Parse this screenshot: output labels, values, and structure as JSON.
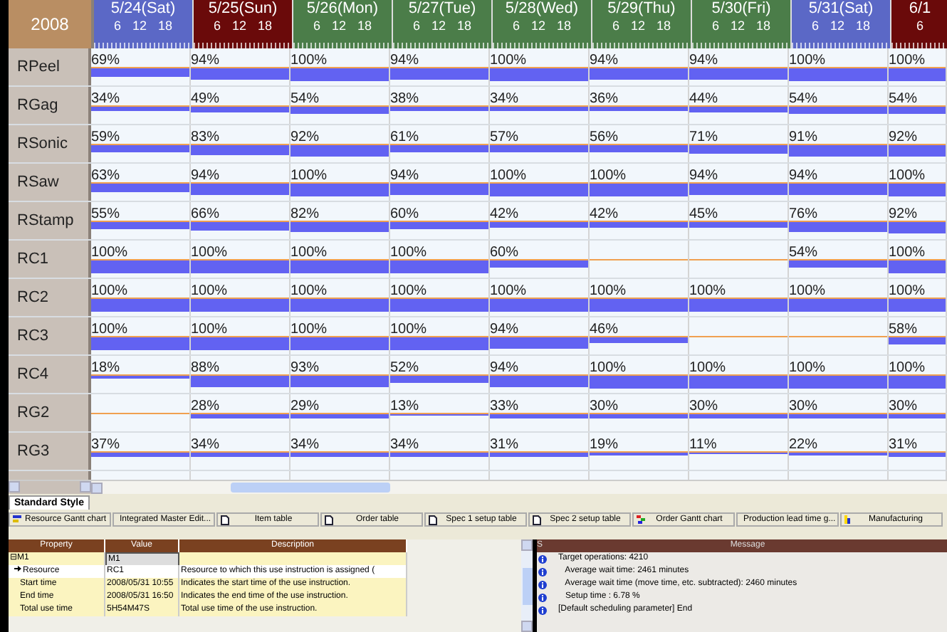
{
  "corner": "2008",
  "days": [
    {
      "label": "5/24(Sat)",
      "kind": "sat",
      "ticks": [
        "6",
        "12",
        "18"
      ]
    },
    {
      "label": "5/25(Sun)",
      "kind": "sun",
      "ticks": [
        "6",
        "12",
        "18"
      ]
    },
    {
      "label": "5/26(Mon)",
      "kind": "weekday",
      "ticks": [
        "6",
        "12",
        "18"
      ]
    },
    {
      "label": "5/27(Tue)",
      "kind": "weekday",
      "ticks": [
        "6",
        "12",
        "18"
      ]
    },
    {
      "label": "5/28(Wed)",
      "kind": "weekday",
      "ticks": [
        "6",
        "12",
        "18"
      ]
    },
    {
      "label": "5/29(Thu)",
      "kind": "weekday",
      "ticks": [
        "6",
        "12",
        "18"
      ]
    },
    {
      "label": "5/30(Fri)",
      "kind": "weekday",
      "ticks": [
        "6",
        "12",
        "18"
      ]
    },
    {
      "label": "5/31(Sat)",
      "kind": "sat",
      "ticks": [
        "6",
        "12",
        "18"
      ]
    },
    {
      "label": "6/1",
      "kind": "sun",
      "ticks": [
        "6"
      ]
    }
  ],
  "resources": [
    {
      "name": "RPeel",
      "cells": [
        "69%",
        "94%",
        "100%",
        "94%",
        "100%",
        "94%",
        "94%",
        "100%",
        "100%"
      ]
    },
    {
      "name": "RGag",
      "cells": [
        "34%",
        "49%",
        "54%",
        "38%",
        "34%",
        "36%",
        "44%",
        "54%",
        "54%"
      ]
    },
    {
      "name": "RSonic",
      "cells": [
        "59%",
        "83%",
        "92%",
        "61%",
        "57%",
        "56%",
        "71%",
        "91%",
        "92%"
      ]
    },
    {
      "name": "RSaw",
      "cells": [
        "63%",
        "94%",
        "100%",
        "94%",
        "100%",
        "100%",
        "94%",
        "94%",
        "100%"
      ]
    },
    {
      "name": "RStamp",
      "cells": [
        "55%",
        "66%",
        "82%",
        "60%",
        "42%",
        "42%",
        "45%",
        "76%",
        "92%"
      ]
    },
    {
      "name": "RC1",
      "cells": [
        "100%",
        "100%",
        "100%",
        "100%",
        "60%",
        null,
        null,
        "54%",
        "100%"
      ]
    },
    {
      "name": "RC2",
      "cells": [
        "100%",
        "100%",
        "100%",
        "100%",
        "100%",
        "100%",
        "100%",
        "100%",
        "100%"
      ]
    },
    {
      "name": "RC3",
      "cells": [
        "100%",
        "100%",
        "100%",
        "100%",
        "94%",
        "46%",
        null,
        null,
        "58%"
      ]
    },
    {
      "name": "RC4",
      "cells": [
        "18%",
        "88%",
        "93%",
        "52%",
        "94%",
        "100%",
        "100%",
        "100%",
        "100%"
      ]
    },
    {
      "name": "RG2",
      "cells": [
        null,
        "28%",
        "29%",
        "13%",
        "33%",
        "30%",
        "30%",
        "30%",
        "30%"
      ]
    },
    {
      "name": "RG3",
      "cells": [
        "37%",
        "34%",
        "34%",
        "34%",
        "31%",
        "19%",
        "11%",
        "22%",
        "31%"
      ]
    }
  ],
  "style_tab": "Standard Style",
  "views": [
    {
      "label": "Resource Gantt chart",
      "kind": "gantt"
    },
    {
      "label": "Integrated Master Edit...",
      "kind": "table"
    },
    {
      "label": "Item table",
      "kind": "table"
    },
    {
      "label": "Order table",
      "kind": "table"
    },
    {
      "label": "Spec 1 setup table",
      "kind": "table"
    },
    {
      "label": "Spec 2 setup table",
      "kind": "table"
    },
    {
      "label": "Order Gantt chart",
      "kind": "order"
    },
    {
      "label": "Production lead time g...",
      "kind": "gantt"
    },
    {
      "label": "Manufacturing",
      "kind": "chart"
    }
  ],
  "properties": {
    "columns": [
      "Property",
      "Value",
      "Description"
    ],
    "rows": [
      {
        "property": "⊟M1",
        "value": "M1",
        "kind": "group"
      },
      {
        "property": "Resource",
        "value": "RC1",
        "description": "Resource to which this use instruction is assigned (",
        "kind": "link"
      },
      {
        "property": "Start time",
        "value": "2008/05/31 10:55",
        "description": "Indicates the start time of the use instruction.",
        "kind": "item"
      },
      {
        "property": "End time",
        "value": "2008/05/31 16:50",
        "description": "Indicates the end time of the use instruction.",
        "kind": "item"
      },
      {
        "property": "Total use time",
        "value": "5H54M47S",
        "description": "Total use time of the use instruction.",
        "kind": "item"
      }
    ]
  },
  "messages": {
    "columns": [
      "S",
      "Message"
    ],
    "rows": [
      "Target operations: 4210",
      "   Average wait time: 2461 minutes",
      "   Average wait time (move time, etc. subtracted): 2460 minutes",
      "   Setup time : 6.78 %",
      "[Default scheduling parameter] End"
    ]
  }
}
